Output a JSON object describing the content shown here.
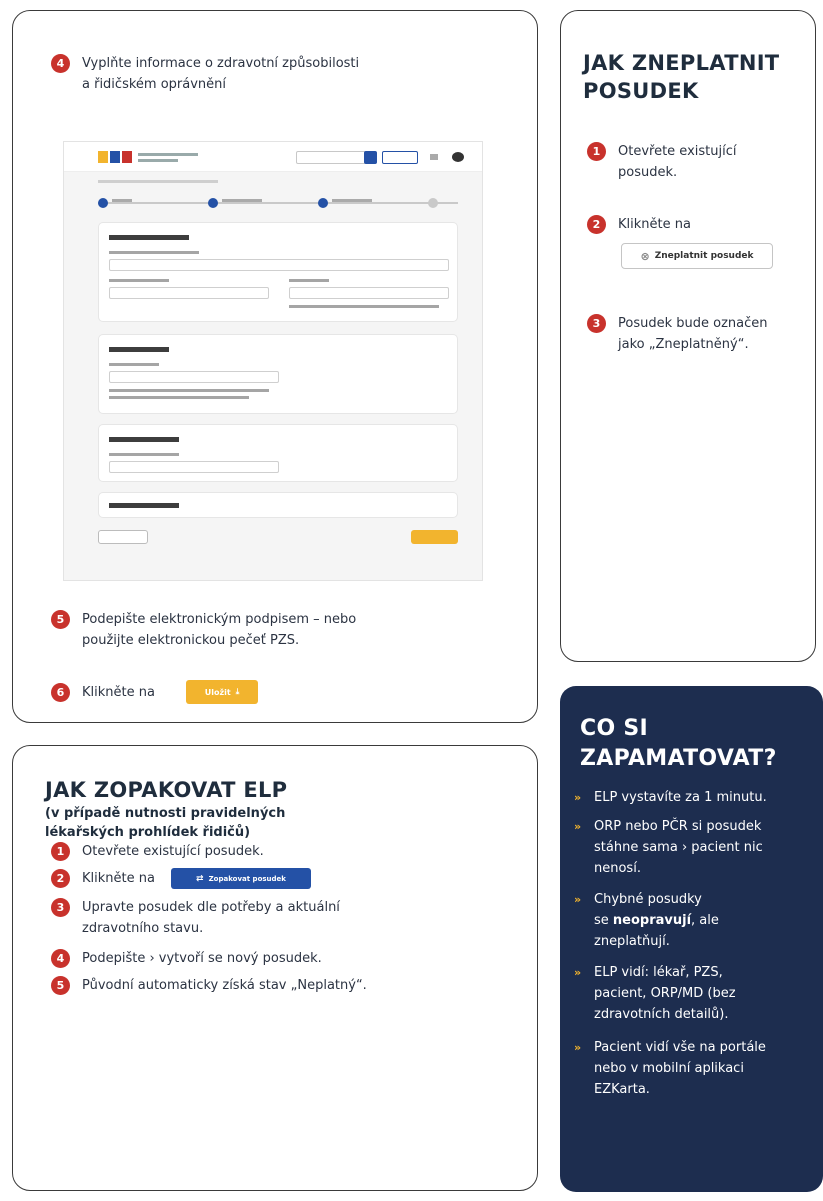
{
  "steps_panel": {
    "step4": {
      "num": "4",
      "line1": "Vyplňte informace o zdravotní způsobilosti",
      "line2": "a řidičském oprávnění"
    },
    "step5": {
      "num": "5",
      "line1": "Podepište elektronickým podpisem – nebo",
      "line2": "použijte elektronickou pečeť PZS."
    },
    "step6": {
      "num": "6",
      "text": "Klikněte na",
      "button_label": "Uložit"
    }
  },
  "invalidate_panel": {
    "title_line1": "JAK ZNEPLATNIT",
    "title_line2": "POSUDEK",
    "step1": {
      "num": "1",
      "line1": "Otevřete existující",
      "line2": "posudek."
    },
    "step2": {
      "num": "2",
      "text": "Klikněte na",
      "button_label": "Zneplatnit posudek"
    },
    "step3": {
      "num": "3",
      "line1": "Posudek bude označen",
      "line2": "jako „Zneplatněný“."
    }
  },
  "repeat_panel": {
    "title": "JAK ZOPAKOVAT ELP",
    "subtitle_line1": "(v případě nutnosti pravidelných",
    "subtitle_line2": "lékařských prohlídek řidičů)",
    "step1": {
      "num": "1",
      "text": "Otevřete existující posudek."
    },
    "step2": {
      "num": "2",
      "text": "Klikněte na",
      "button_label": "Zopakovat posudek"
    },
    "step3": {
      "num": "3",
      "line1": "Upravte posudek dle potřeby a aktuální",
      "line2": "zdravotního stavu."
    },
    "step4": {
      "num": "4",
      "text": "Podepište › vytvoří se nový posudek."
    },
    "step5": {
      "num": "5",
      "text": "Původní automaticky získá stav „Neplatný“."
    }
  },
  "remember_panel": {
    "title_line1": "CO SI",
    "title_line2": "ZAPAMATOVAT?",
    "bullet_glyph": "»",
    "b1": [
      "ELP vystavíte za 1 minutu."
    ],
    "b2": [
      "ORP nebo PČR si posudek",
      "stáhne sama › pacient nic",
      "nenosí."
    ],
    "b3": {
      "l1": "Chybné posudky",
      "l2_pre": "se ",
      "l2_bold": "neopravují",
      "l2_post": ", ale",
      "l3": "zneplatňují."
    },
    "b4": [
      "ELP vidí: lékař, PZS,",
      "pacient, ORP/MD (bez",
      "zdravotních detailů)."
    ],
    "b5": [
      "Pacient vidí vše na portále",
      "nebo v mobilní aplikaci",
      "EZKarta."
    ]
  },
  "colors": {
    "accent_red": "#c8322c",
    "navy": "#1d2d4f",
    "yellow": "#f2b42e",
    "blue": "#2451a6"
  }
}
